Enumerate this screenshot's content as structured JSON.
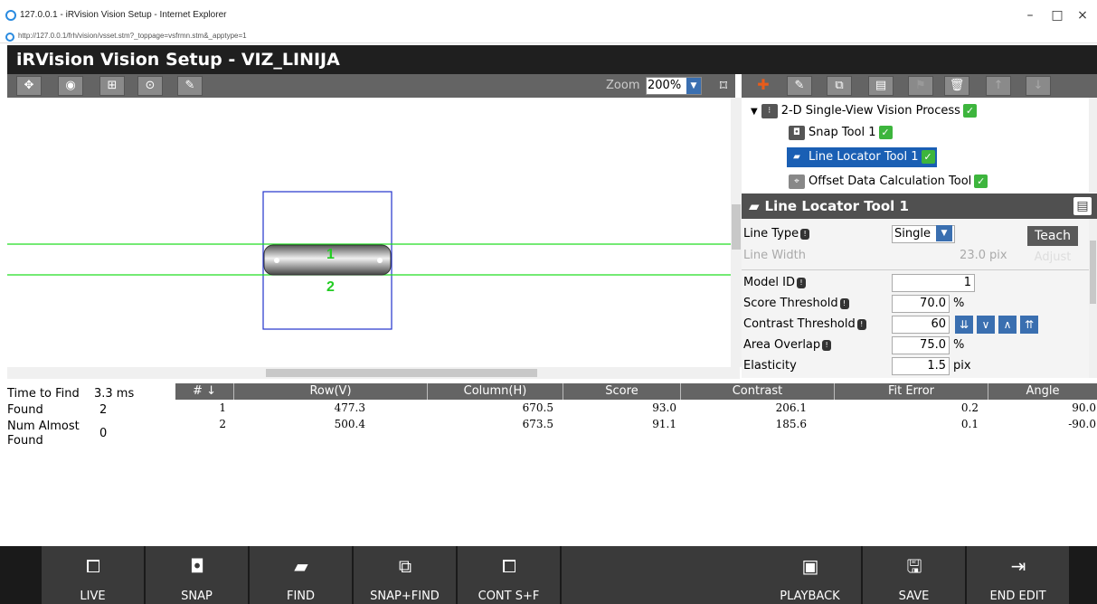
{
  "window": {
    "title": "127.0.0.1 - iRVision Vision Setup - Internet Explorer",
    "minimize": "–",
    "maximize": "□",
    "close": "×"
  },
  "address": {
    "url": "http://127.0.0.1/frh/vision/vsset.stm?_toppage=vsfrmn.stm&_apptype=1"
  },
  "app": {
    "title": "iRVision Vision Setup - VIZ_LINIJA"
  },
  "image_toolbar": {
    "zoom_label": "Zoom",
    "zoom_value": "200%",
    "buttons": [
      "pointer-icon",
      "snap-mode-icon",
      "grab-icon",
      "center-icon",
      "pen-icon"
    ]
  },
  "image": {
    "labels": [
      "1",
      "2"
    ],
    "colors": {
      "line": "#22dd22",
      "roi": "#2233cc"
    }
  },
  "tree": {
    "items": [
      {
        "label": "2-D Single-View Vision Process",
        "icon": "process-icon",
        "checked": true
      },
      {
        "label": "Snap Tool 1",
        "icon": "camera-icon",
        "checked": true
      },
      {
        "label": "Line Locator Tool 1",
        "icon": "line-locator-icon",
        "checked": true,
        "selected": true
      },
      {
        "label": "Offset Data Calculation Tool",
        "icon": "offset-icon",
        "checked": true
      }
    ]
  },
  "prop_panel": {
    "title": "Line Locator Tool 1",
    "line_type_label": "Line Type",
    "line_type_value": "Single",
    "teach_label": "Teach",
    "line_width_label": "Line Width",
    "line_width_value": "23.0",
    "line_width_unit": "pix",
    "adjust_label": "Adjust",
    "model_id_label": "Model ID",
    "model_id_value": "1",
    "score_label": "Score Threshold",
    "score_value": "70.0",
    "score_unit": "%",
    "contrast_label": "Contrast Threshold",
    "contrast_value": "60",
    "area_label": "Area Overlap",
    "area_value": "75.0",
    "area_unit": "%",
    "elasticity_label": "Elasticity",
    "elasticity_value": "1.5",
    "elasticity_unit": "pix"
  },
  "results": {
    "time_to_find_label": "Time to Find",
    "time_to_find_value": "3.3 ms",
    "found_label": "Found",
    "found_value": "2",
    "almost_label": "Num Almost Found",
    "almost_value": "0",
    "columns": [
      "#",
      "Row(V)",
      "Column(H)",
      "Score",
      "Contrast",
      "Fit Error",
      "Angle"
    ],
    "rows": [
      [
        "1",
        "477.3",
        "670.5",
        "93.0",
        "206.1",
        "0.2",
        "90.0"
      ],
      [
        "2",
        "500.4",
        "673.5",
        "91.1",
        "185.6",
        "0.1",
        "-90.0"
      ]
    ]
  },
  "bottom": {
    "buttons": [
      {
        "label": "LIVE",
        "icon": "live-icon"
      },
      {
        "label": "SNAP",
        "icon": "snap-icon"
      },
      {
        "label": "FIND",
        "icon": "find-icon"
      },
      {
        "label": "SNAP+FIND",
        "icon": "snap-find-icon"
      },
      {
        "label": "CONT S+F",
        "icon": "cont-icon"
      },
      {
        "label": "",
        "icon": ""
      },
      {
        "label": "",
        "icon": ""
      },
      {
        "label": "PLAYBACK",
        "icon": "playback-icon"
      },
      {
        "label": "SAVE",
        "icon": "save-icon"
      },
      {
        "label": "END EDIT",
        "icon": "end-edit-icon"
      }
    ]
  }
}
